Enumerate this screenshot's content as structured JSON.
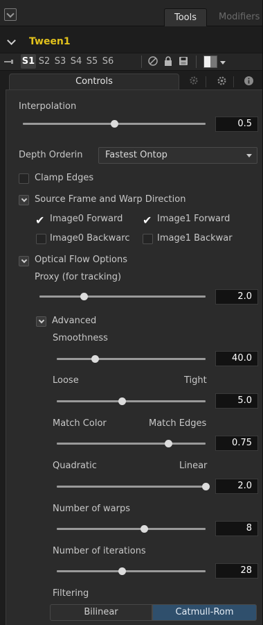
{
  "tabs": {
    "active": "Tools",
    "inactive": "Modifiers"
  },
  "tool": {
    "name": "Tween1"
  },
  "versions": {
    "slots": [
      "S1",
      "S2",
      "S3",
      "S4",
      "S5",
      "S6"
    ],
    "selected": "S1",
    "icons": [
      "pin-icon",
      "disable-icon",
      "lock-icon",
      "save-icon",
      "color-swatch-icon",
      "chevron-down-icon"
    ]
  },
  "control_tabs": {
    "active": "Controls",
    "icons": [
      "settings-gear-icon",
      "info-icon"
    ]
  },
  "interpolation": {
    "label": "Interpolation",
    "value": "0.5",
    "fraction": 0.5
  },
  "depth_ordering": {
    "label": "Depth Orderin",
    "value": "Fastest Ontop"
  },
  "clamp_edges": {
    "label": "Clamp Edges",
    "checked": false
  },
  "source_frame": {
    "label": "Source Frame and Warp Direction",
    "image0_forward": {
      "label": "Image0 Forward",
      "checked": true
    },
    "image1_forward": {
      "label": "Image1 Forward",
      "checked": true
    },
    "image0_backward": {
      "label": "Image0 Backwarc",
      "checked": false
    },
    "image1_backward": {
      "label": "Image1 Backwar",
      "checked": false
    }
  },
  "optical_flow": {
    "label": "Optical Flow Options",
    "proxy": {
      "label": "Proxy (for tracking)",
      "value": "2.0",
      "fraction": 0.27
    },
    "advanced": {
      "label": "Advanced",
      "smoothness": {
        "label": "Smoothness",
        "value": "40.0",
        "fraction": 0.26
      },
      "loose_tight": {
        "left": "Loose",
        "right": "Tight",
        "value": "5.0",
        "fraction": 0.44
      },
      "match": {
        "left": "Match Color",
        "right": "Match Edges",
        "value": "0.75",
        "fraction": 0.75
      },
      "quadratic_linear": {
        "left": "Quadratic",
        "right": "Linear",
        "value": "2.0",
        "fraction": 1.0
      },
      "warps": {
        "label": "Number of warps",
        "value": "8",
        "fraction": 0.59
      },
      "iterations": {
        "label": "Number of iterations",
        "value": "28",
        "fraction": 0.44
      },
      "filtering": {
        "label": "Filtering",
        "options": [
          "Bilinear",
          "Catmull-Rom"
        ],
        "selected": "Catmull-Rom"
      }
    }
  },
  "colors": {
    "tool_name": "#e2c21c",
    "selected_segment": "#2f4f6c",
    "background": "#2b2b2b"
  }
}
